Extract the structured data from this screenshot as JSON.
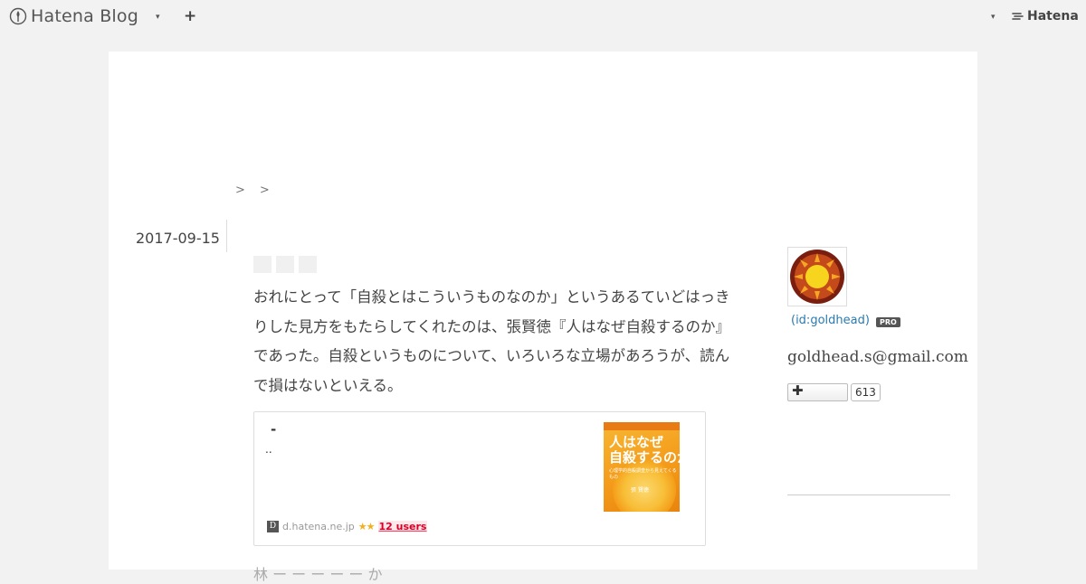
{
  "topbar": {
    "brand": "Hatena Blog",
    "brand_icon": "hatena-blog-logo-icon",
    "add_icon": "+",
    "right_brand": "Hatena",
    "caret": "▾"
  },
  "breadcrumb": [
    ">",
    ">"
  ],
  "entry": {
    "date": "2017-09-15",
    "body_lines": [
      "おれにとって「自殺とはこういうものなのか」というあるていどはっき",
      "りした見方をもたらしてくれたのは、張賢徳『人はなぜ自殺するのか』",
      "であった。自殺というものについて、いろいろな立場があろうが、読ん",
      "で損はないといえる。"
    ],
    "cutoff_text": "林 ー ー ー ー ー か"
  },
  "embed": {
    "title": "-",
    "description": "..",
    "thumb_title": "人はなぜ\n自殺するのか",
    "thumb_sub": "心理学的自殺調査から見えてくるもの",
    "thumb_author": "張 賢徳",
    "favicon": "D",
    "domain": "d.hatena.ne.jp",
    "stars": "★★",
    "users": "12 users"
  },
  "sidebar": {
    "profile_id": "(id:goldhead)",
    "badge": "PRO",
    "email": "goldhead.s@gmail.com",
    "follow_icon": "✚",
    "follow_count": "613"
  },
  "colors": {
    "background": "#f2f2f2",
    "card": "#ffffff",
    "link": "#2a7ab0",
    "users": "#d60026",
    "star": "#f2b01e"
  }
}
